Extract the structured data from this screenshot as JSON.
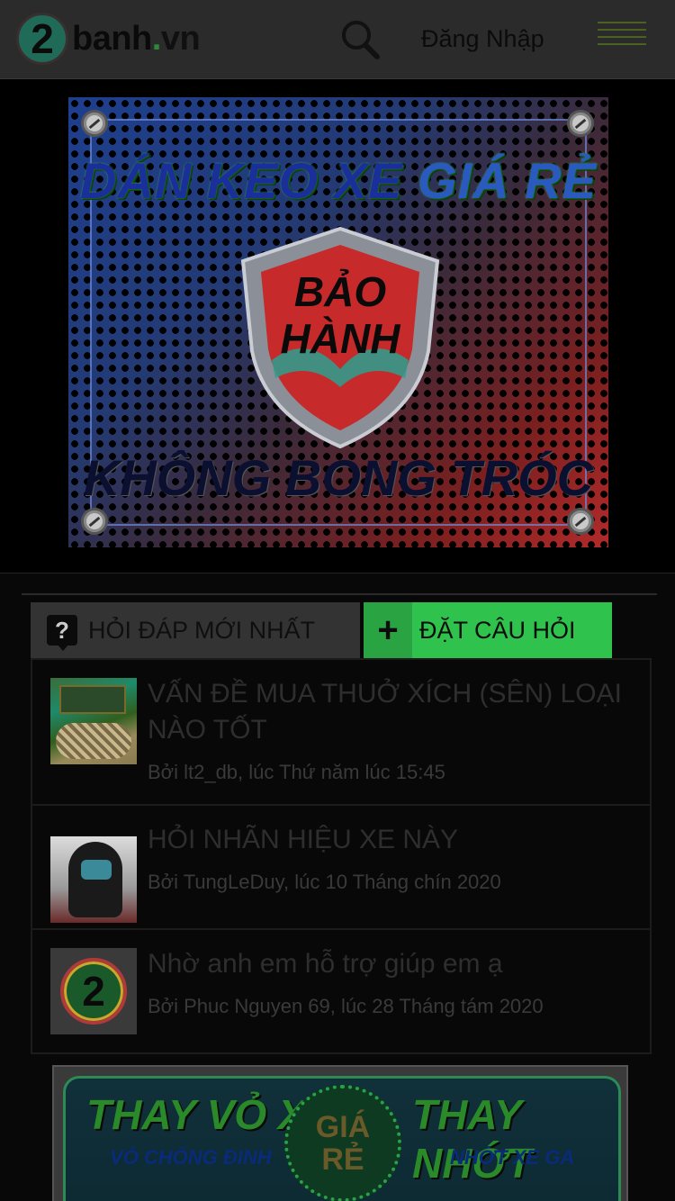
{
  "header": {
    "logo_number": "2",
    "logo_name": "banh",
    "logo_dot": ".",
    "logo_tld": "vn",
    "login_label": "Đăng Nhập"
  },
  "top_banner": {
    "line1_a": "DÁN KEO XE",
    "line1_b": "GIÁ RẺ",
    "shield_line1": "BẢO",
    "shield_line2": "HÀNH",
    "line2": "KHÔNG BONG TRÓC"
  },
  "qa": {
    "tab_label": "HỎI ĐÁP MỚI NHẤT",
    "ask_plus": "+",
    "ask_label": "ĐẶT CÂU HỎI",
    "items": [
      {
        "title": "VẤN ĐỀ MUA THUỞ XÍCH (SÊN) LOẠI NÀO TỐT",
        "meta": "Bởi lt2_db, lúc Thứ năm lúc 15:45"
      },
      {
        "title": "HỎI NHÃN HIỆU XE NÀY",
        "meta": "Bởi TungLeDuy, lúc 10 Tháng chín 2020"
      },
      {
        "title": "Nhờ anh em hỗ trợ giúp em ạ",
        "meta": "Bởi Phuc Nguyen 69, lúc 28 Tháng tám 2020",
        "thumb_number": "2"
      }
    ]
  },
  "bottom_banner": {
    "left_title": "THAY VỎ XE",
    "left_sub": "VỎ CHỐNG ĐINH",
    "badge_line1": "GIÁ",
    "badge_line2": "RẺ",
    "right_title": "THAY NHỚT",
    "right_sub": "NHỚT XE GA"
  },
  "colors": {
    "header_bg": "#2b2b2b",
    "accent_green": "#2fc24c",
    "tab_bg": "#333333",
    "page_bg": "#000000"
  }
}
